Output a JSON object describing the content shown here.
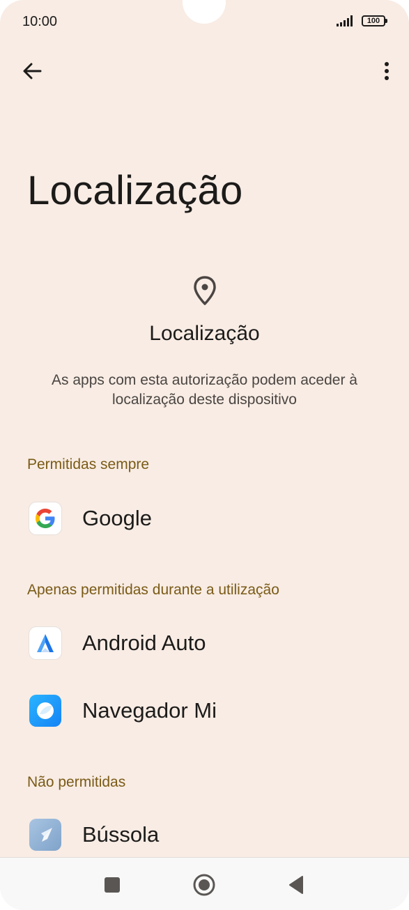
{
  "status_bar": {
    "time": "10:00",
    "battery": "100"
  },
  "page": {
    "title": "Localização"
  },
  "header": {
    "icon": "location-pin-icon",
    "label": "Localização",
    "description": "As apps com esta autorização podem aceder à localização deste dispositivo"
  },
  "sections": [
    {
      "title": "Permitidas sempre",
      "apps": [
        {
          "label": "Google",
          "icon": "google-icon"
        }
      ]
    },
    {
      "title": "Apenas permitidas durante a utilização",
      "apps": [
        {
          "label": "Android Auto",
          "icon": "android-auto-icon"
        },
        {
          "label": "Navegador Mi",
          "icon": "mi-browser-icon"
        }
      ]
    },
    {
      "title": "Não permitidas",
      "apps": [
        {
          "label": "Bússola",
          "icon": "compass-icon"
        }
      ]
    }
  ],
  "colors": {
    "background": "#f8ece4",
    "section_title": "#7a5a16",
    "text": "#1c1b1a"
  }
}
